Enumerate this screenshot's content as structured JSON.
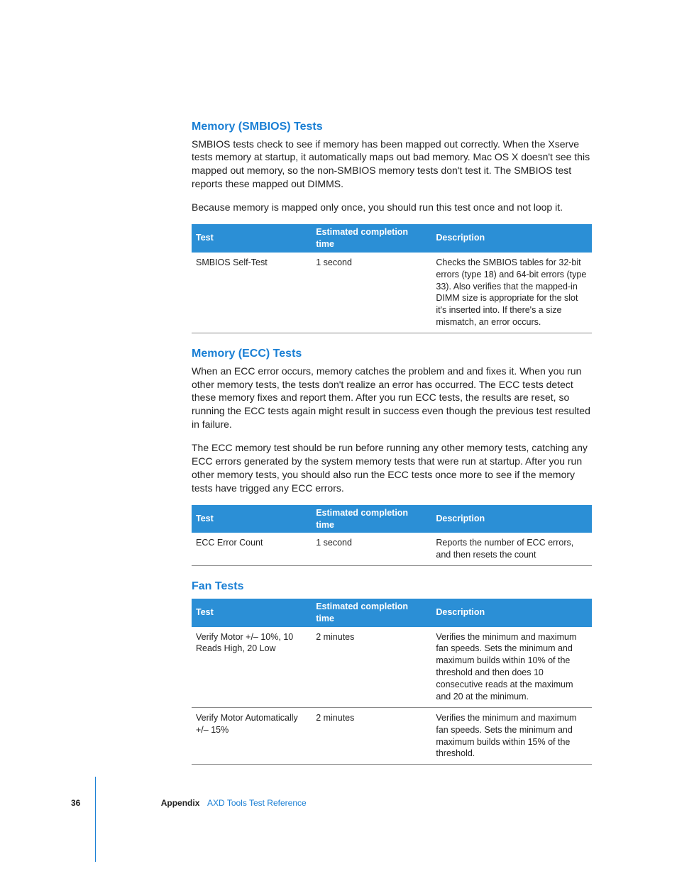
{
  "sections": [
    {
      "heading": "Memory (SMBIOS) Tests",
      "paragraphs": [
        "SMBIOS tests check to see if memory has been mapped out correctly. When the Xserve tests memory at startup, it automatically maps out bad memory. Mac OS X doesn't see this mapped out memory, so the non-SMBIOS memory tests don't test it. The SMBIOS test reports these mapped out DIMMS.",
        "Because memory is mapped only once, you should run this test once and not loop it."
      ],
      "table": {
        "headers": [
          "Test",
          "Estimated completion time",
          "Description"
        ],
        "rows": [
          {
            "test": "SMBIOS Self-Test",
            "time": "1 second",
            "desc": "Checks the SMBIOS tables for 32-bit errors (type 18) and 64-bit errors (type 33). Also verifies that the mapped-in DIMM size is appropriate for the slot it's inserted into. If there's a size mismatch, an error occurs."
          }
        ]
      }
    },
    {
      "heading": "Memory (ECC) Tests",
      "paragraphs": [
        "When an ECC error occurs, memory catches the problem and and fixes it. When you run other memory tests, the tests don't realize an error has occurred. The ECC tests detect these memory fixes and report them. After you run ECC tests, the results are reset, so running the ECC tests again might result in success even though the previous test resulted in failure.",
        "The ECC memory test should be run before running any other memory tests, catching any ECC errors generated by the system memory tests that were run at startup. After you run other memory tests, you should also run the ECC tests once more to see if the memory tests have trigged any ECC errors."
      ],
      "table": {
        "headers": [
          "Test",
          "Estimated completion time",
          "Description"
        ],
        "rows": [
          {
            "test": "ECC Error Count",
            "time": "1 second",
            "desc": "Reports the number of ECC errors, and then resets the count"
          }
        ]
      }
    },
    {
      "heading": "Fan Tests",
      "paragraphs": [],
      "table": {
        "headers": [
          "Test",
          "Estimated completion time",
          "Description"
        ],
        "rows": [
          {
            "test": "Verify Motor +/– 10%, 10 Reads High, 20 Low",
            "time": "2 minutes",
            "desc": "Verifies the minimum and maximum fan speeds. Sets the minimum and maximum builds within 10% of the threshold and then does 10 consecutive reads at the maximum and 20 at the minimum."
          },
          {
            "test": "Verify Motor Automatically +/– 15%",
            "time": "2 minutes",
            "desc": "Verifies the minimum and maximum fan speeds. Sets the minimum and maximum builds within 15% of the threshold."
          }
        ]
      }
    }
  ],
  "footer": {
    "page": "36",
    "appendix": "Appendix",
    "title": "AXD Tools Test Reference"
  }
}
